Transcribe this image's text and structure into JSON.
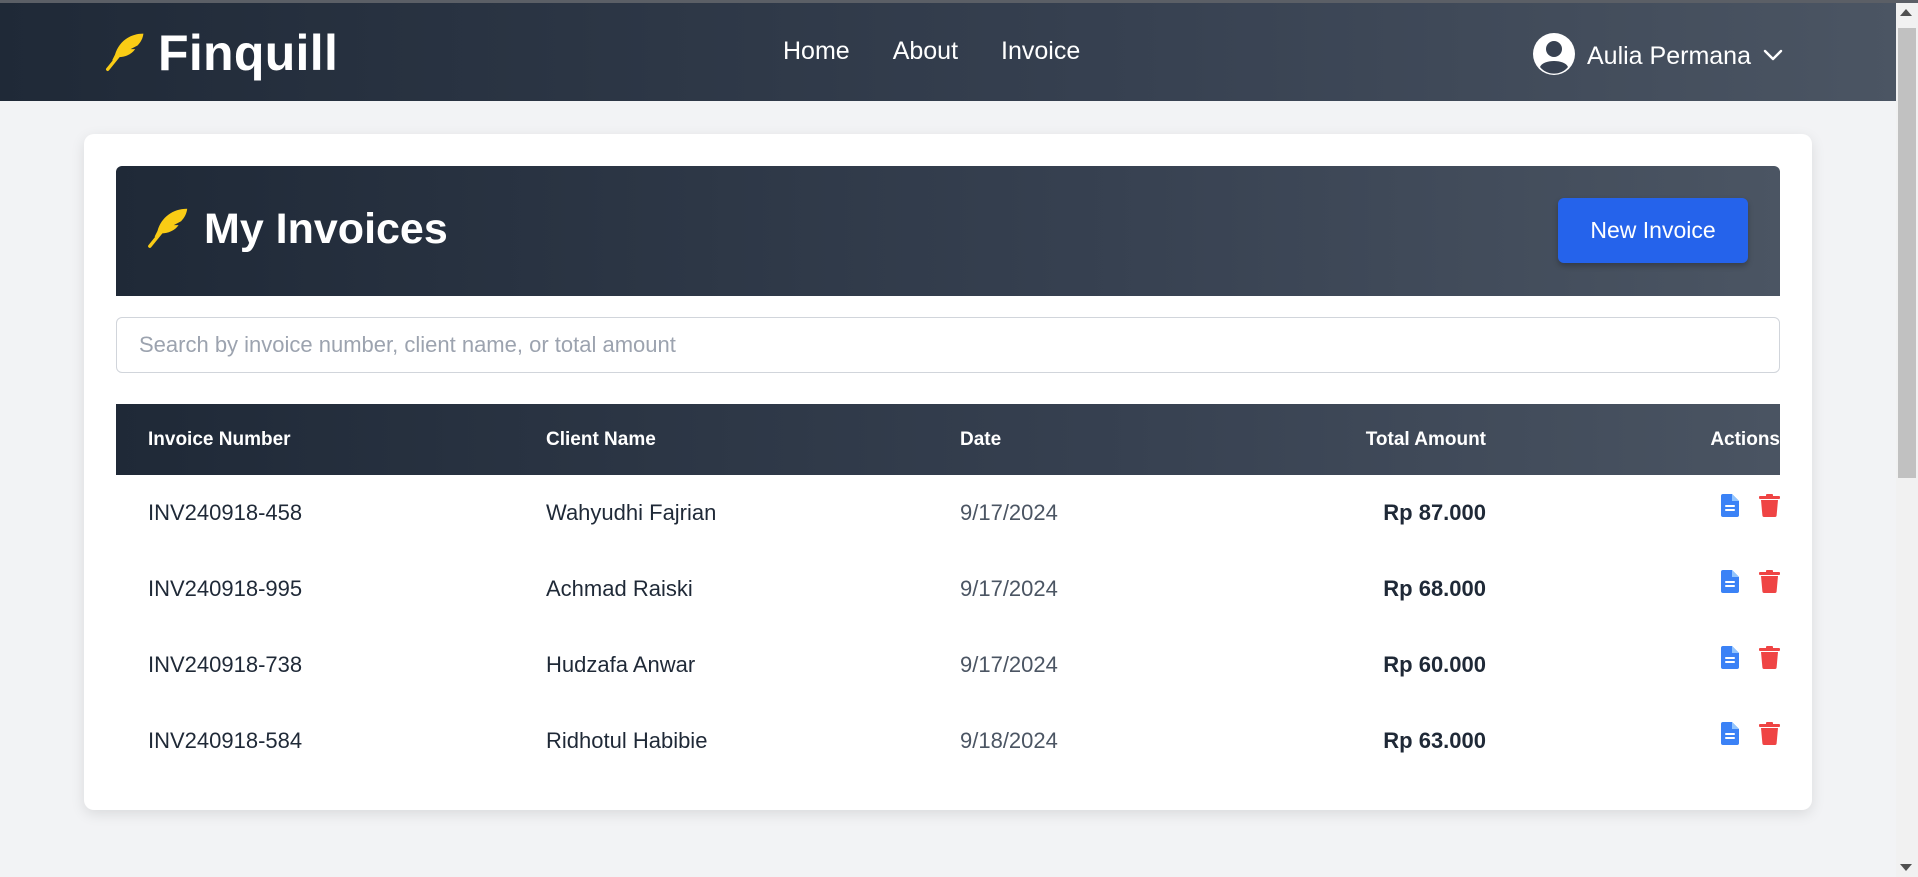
{
  "app": {
    "name": "Finquill"
  },
  "nav": {
    "links": [
      {
        "label": "Home"
      },
      {
        "label": "About"
      },
      {
        "label": "Invoice"
      }
    ],
    "user": {
      "name": "Aulia Permana",
      "avatar_icon": "user-circle-icon",
      "dropdown_icon": "chevron-down-icon"
    }
  },
  "page": {
    "title": "My Invoices",
    "title_icon": "feather-icon",
    "new_invoice_label": "New Invoice",
    "search_placeholder": "Search by invoice number, client name, or total amount",
    "search_value": ""
  },
  "table": {
    "headers": {
      "invoice_number": "Invoice Number",
      "client_name": "Client Name",
      "date": "Date",
      "total_amount": "Total Amount",
      "actions": "Actions"
    },
    "rows": [
      {
        "invoice_number": "INV240918-458",
        "client_name": "Wahyudhi Fajrian",
        "date": "9/17/2024",
        "total": "Rp 87.000"
      },
      {
        "invoice_number": "INV240918-995",
        "client_name": "Achmad Raiski",
        "date": "9/17/2024",
        "total": "Rp 68.000"
      },
      {
        "invoice_number": "INV240918-738",
        "client_name": "Hudzafa Anwar",
        "date": "9/17/2024",
        "total": "Rp 60.000"
      },
      {
        "invoice_number": "INV240918-584",
        "client_name": "Ridhotul Habibie",
        "date": "9/18/2024",
        "total": "Rp 63.000"
      }
    ],
    "row_actions": [
      {
        "icon": "document-icon",
        "color": "#3b82f6"
      },
      {
        "icon": "trash-icon",
        "color": "#ef4444"
      }
    ]
  },
  "colors": {
    "brand_accent": "#facc15",
    "header_gradient_start": "#1f2937",
    "header_gradient_end": "#4b5563",
    "primary_button": "#2563eb",
    "view_icon": "#3b82f6",
    "delete_icon": "#ef4444"
  }
}
